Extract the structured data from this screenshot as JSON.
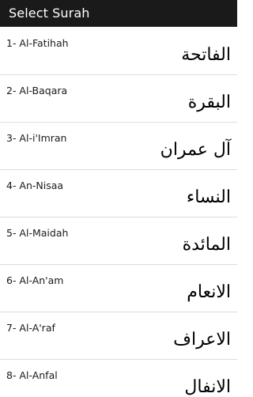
{
  "header": {
    "title": "Select Surah"
  },
  "surahs": [
    {
      "label": "1- Al-Fatihah",
      "arabic": "الفاتحة"
    },
    {
      "label": "2- Al-Baqara",
      "arabic": "البقرة"
    },
    {
      "label": "3- Al-i'Imran",
      "arabic": "آل عمران"
    },
    {
      "label": "4- An-Nisaa",
      "arabic": "النساء"
    },
    {
      "label": "5- Al-Maidah",
      "arabic": "المائدة"
    },
    {
      "label": "6- Al-An'am",
      "arabic": "الانعام"
    },
    {
      "label": "7- Al-A'raf",
      "arabic": "الاعراف"
    },
    {
      "label": "8- Al-Anfal",
      "arabic": "الانفال"
    }
  ]
}
